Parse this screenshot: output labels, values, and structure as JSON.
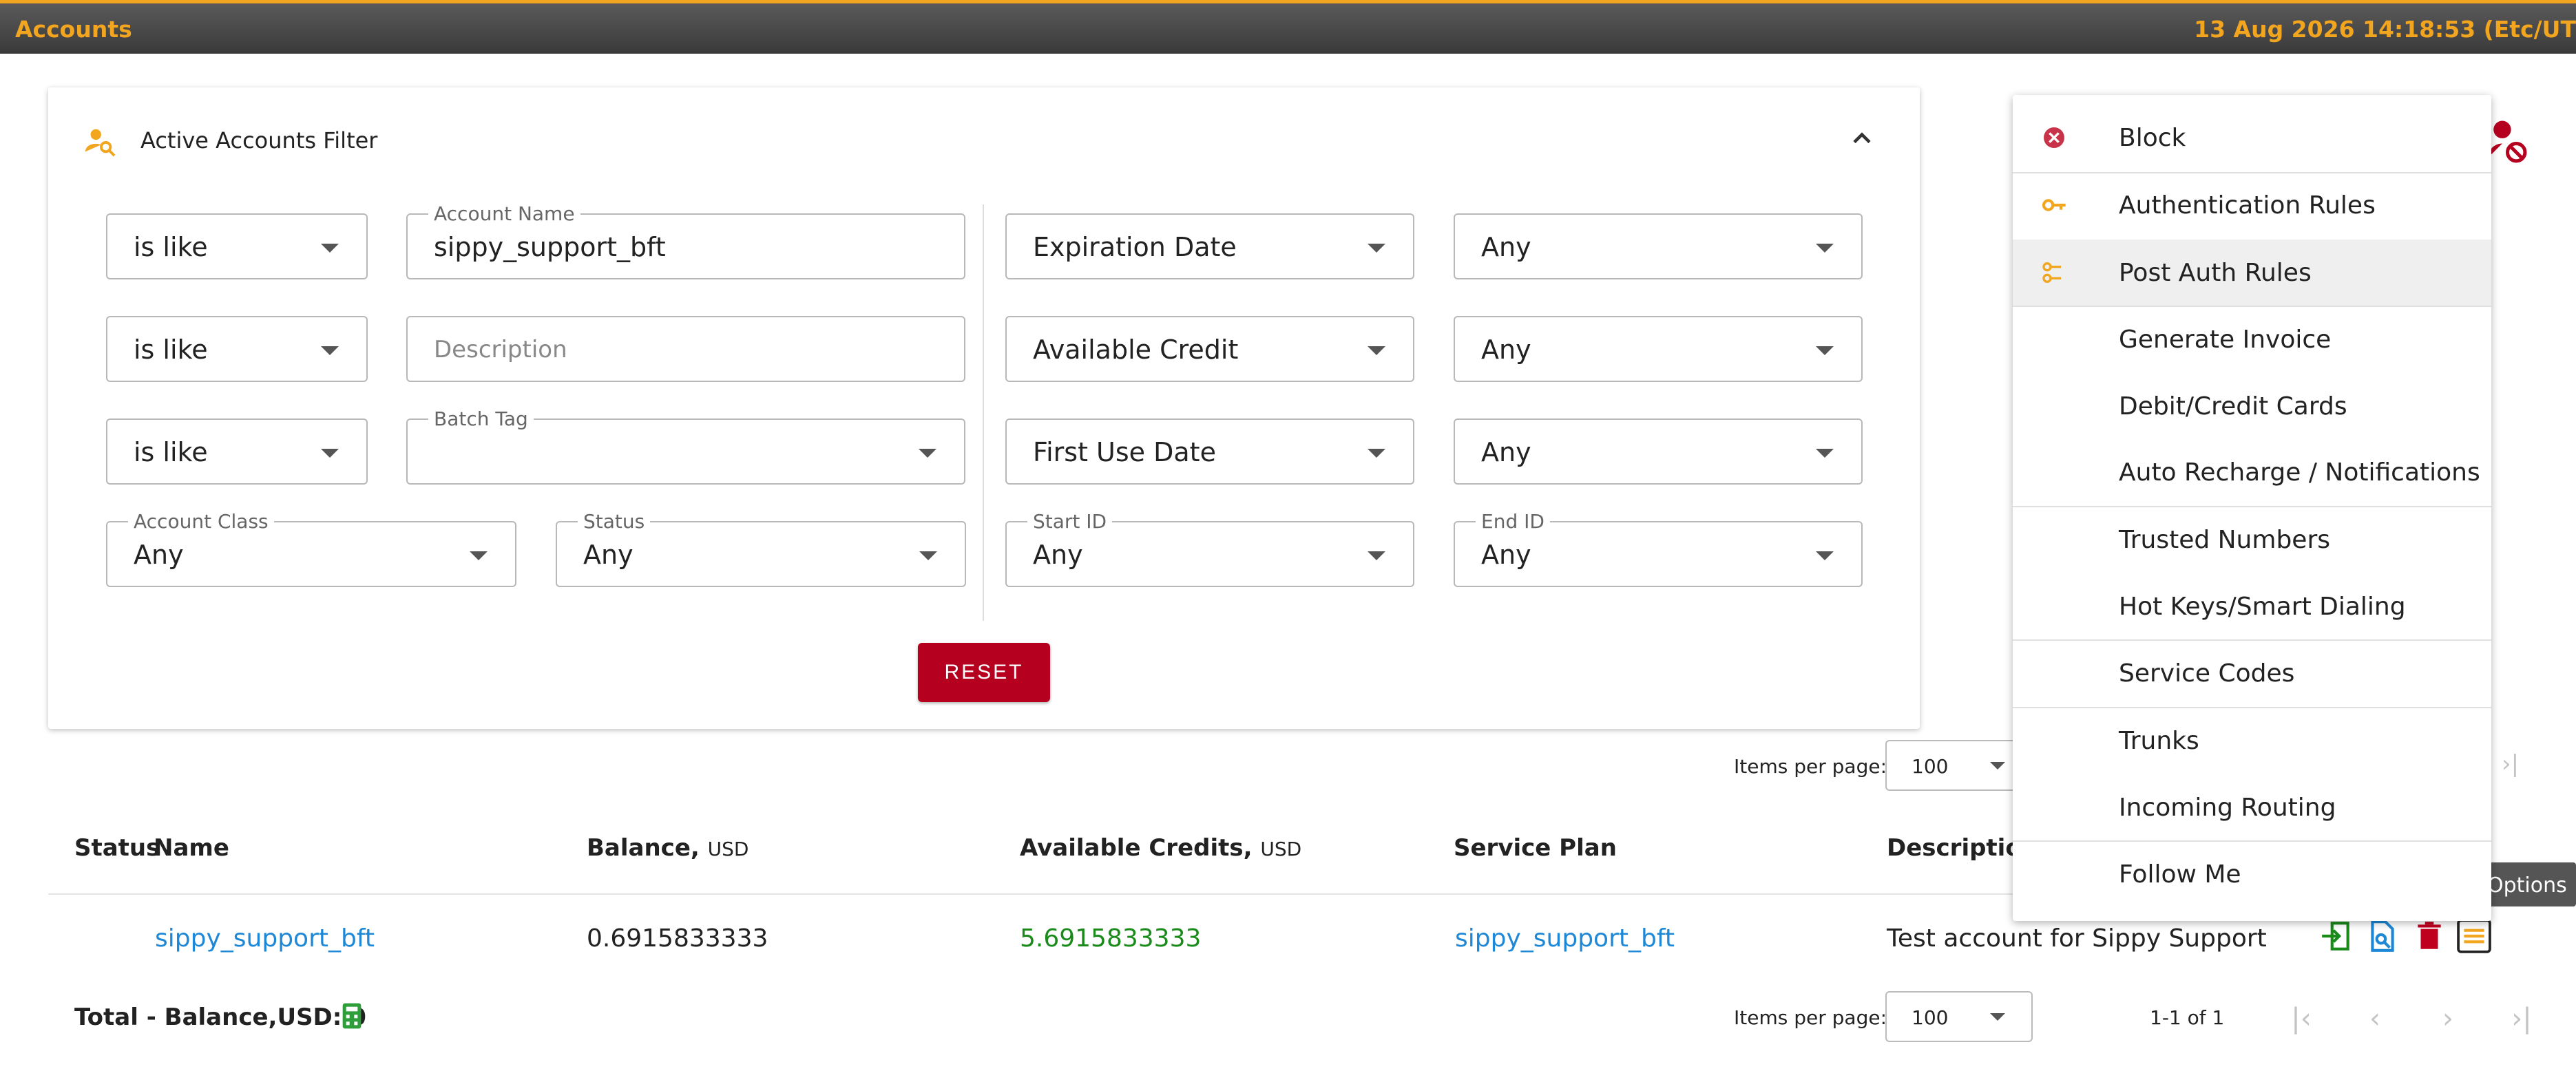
{
  "header": {
    "title": "Accounts",
    "clock": "13 Aug 2026 14:18:53 (Etc/UT"
  },
  "filter": {
    "title": "Active Accounts Filter",
    "row1": {
      "op": "is like",
      "name_label": "Account Name",
      "name_value": "sippy_support_bft",
      "date_field": "Expiration Date",
      "date_value": "Any"
    },
    "row2": {
      "op": "is like",
      "desc_placeholder": "Description",
      "credit_field": "Available Credit",
      "credit_value": "Any"
    },
    "row3": {
      "op": "is like",
      "batch_label": "Batch Tag",
      "batch_value": "",
      "first_use_field": "First Use Date",
      "first_use_value": "Any"
    },
    "row4": {
      "class_label": "Account Class",
      "class_value": "Any",
      "status_label": "Status",
      "status_value": "Any",
      "start_label": "Start ID",
      "start_value": "Any",
      "end_label": "End ID",
      "end_value": "Any"
    },
    "reset_label": "RESET"
  },
  "pagination_top": {
    "label": "Items per page:",
    "value": "100",
    "last": "›|"
  },
  "table": {
    "headers": {
      "status": "Status",
      "name": "Name",
      "balance": "Balance,",
      "balance_unit": "USD",
      "credits": "Available Credits,",
      "credits_unit": "USD",
      "plan": "Service Plan",
      "description": "Description"
    },
    "row": {
      "name": "sippy_support_bft",
      "balance": "0.6915833333",
      "credits": "5.6915833333",
      "plan": "sippy_support_bft",
      "description": "Test account for Sippy Support"
    }
  },
  "footer": {
    "total": "Total - Balance,USD: 0",
    "ipp_label": "Items per page:",
    "ipp_value": "100",
    "range": "1-1 of 1",
    "first": "|‹",
    "prev": "‹",
    "next": "›",
    "last": "›|"
  },
  "menu": {
    "items": [
      "Block",
      "Authentication Rules",
      "Post Auth Rules",
      "Generate Invoice",
      "Debit/Credit Cards",
      "Auto Recharge / Notifications",
      "Trusted Numbers",
      "Hot Keys/Smart Dialing",
      "Service Codes",
      "Trunks",
      "Incoming Routing",
      "Follow Me"
    ]
  },
  "tooltip": "Options",
  "colors": {
    "accent": "#f2a51f",
    "danger": "#b5001f",
    "link": "#1e88d6",
    "positive": "#1a8a1a"
  }
}
